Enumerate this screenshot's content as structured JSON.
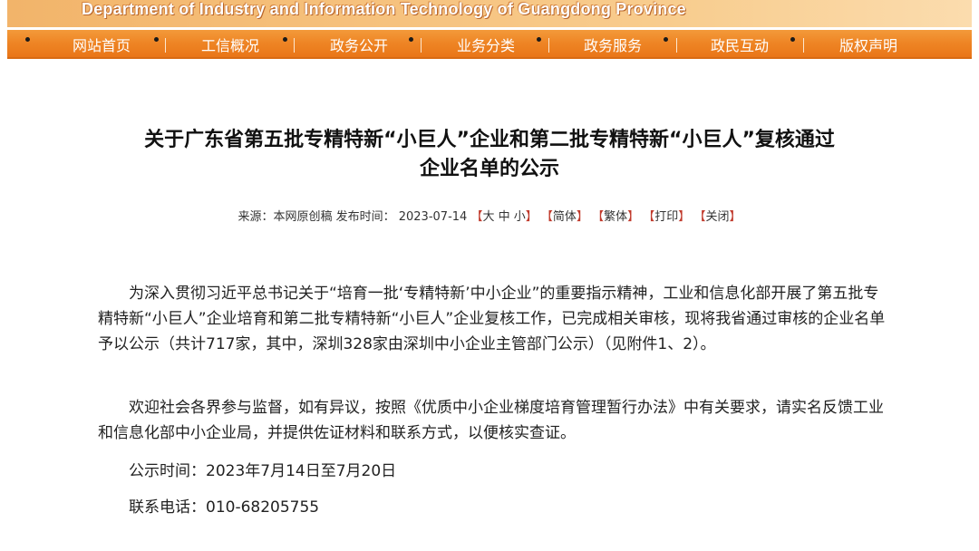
{
  "header": {
    "banner_title": "Department of Industry and Information Technology of Guangdong Province"
  },
  "nav": {
    "items": [
      {
        "label": "网站首页"
      },
      {
        "label": "工信概况"
      },
      {
        "label": "政务公开"
      },
      {
        "label": "业务分类"
      },
      {
        "label": "政务服务"
      },
      {
        "label": "政民互动"
      },
      {
        "label": "版权声明"
      }
    ]
  },
  "article": {
    "title_line1": "关于广东省第五批专精特新“小巨人”企业和第二批专精特新“小巨人”复核通过",
    "title_line2": "企业名单的公示",
    "meta": {
      "source": "来源：本网原创稿 发布时间：  2023-07-14",
      "font_size_label": "大 中 小",
      "simplified": "简体",
      "traditional": "繁体",
      "print": "打印",
      "close": "关闭"
    },
    "paragraph1": "为深入贯彻习近平总书记关于“培育一批‘专精特新’中小企业”的重要指示精神，工业和信息化部开展了第五批专精特新“小巨人”企业培育和第二批专精特新“小巨人”企业复核工作，已完成相关审核，现将我省通过审核的企业名单予以公示（共计717家，其中，深圳328家由深圳中小企业主管部门公示）（见附件1、2）。",
    "paragraph2": "欢迎社会各界参与监督，如有异议，按照《优质中小企业梯度培育管理暂行办法》中有关要求，请实名反馈工业和信息化部中小企业局，并提供佐证材料和联系方式，以便核实查证。",
    "notice_time": "公示时间：2023年7月14日至7月20日",
    "contact_phone": "联系电话：010-68205755"
  }
}
